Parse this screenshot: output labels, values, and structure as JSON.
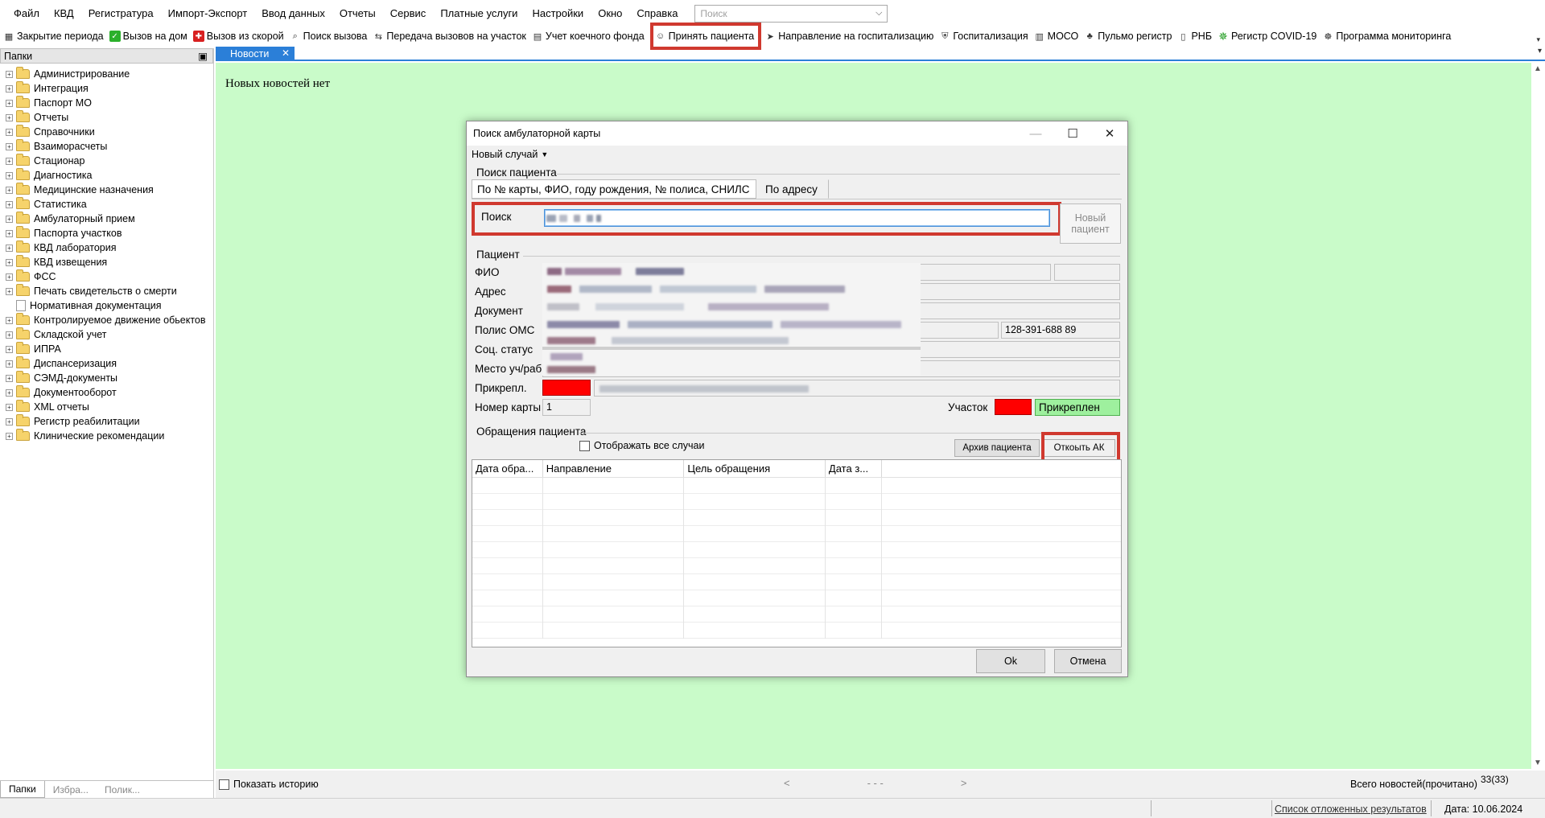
{
  "menubar": {
    "items": [
      "Файл",
      "КВД",
      "Регистратура",
      "Импорт-Экспорт",
      "Ввод данных",
      "Отчеты",
      "Сервис",
      "Платные услуги",
      "Настройки",
      "Окно",
      "Справка"
    ],
    "search_placeholder": "Поиск"
  },
  "toolbar": {
    "items": [
      {
        "label": "Закрытие периода",
        "icon": "period-close-icon"
      },
      {
        "label": "Вызов на дом",
        "icon": "house-call-icon"
      },
      {
        "label": "Вызов из скорой",
        "icon": "ambulance-call-icon"
      },
      {
        "label": "Поиск вызова",
        "icon": "search-call-icon"
      },
      {
        "label": "Передача вызовов на участок",
        "icon": "transfer-icon"
      },
      {
        "label": "Учет коечного фонда",
        "icon": "bed-fund-icon"
      },
      {
        "label": "Принять пациента",
        "icon": "accept-patient-icon"
      },
      {
        "label": "Направление на госпитализацию",
        "icon": "referral-icon"
      },
      {
        "label": "Госпитализация",
        "icon": "hospitalization-icon"
      },
      {
        "label": "МОСО",
        "icon": "moso-icon"
      },
      {
        "label": "Пульмо регистр",
        "icon": "pulmo-icon"
      },
      {
        "label": "РНБ",
        "icon": "rnb-icon"
      },
      {
        "label": "Регистр COVID-19",
        "icon": "covid-icon"
      },
      {
        "label": "Программа мониторинга",
        "icon": "monitoring-icon"
      }
    ]
  },
  "left_panel": {
    "header": "Папки",
    "pin": "⯒",
    "tree": [
      {
        "label": "Администрирование",
        "type": "folder"
      },
      {
        "label": "Интеграция",
        "type": "folder"
      },
      {
        "label": "Паспорт МО",
        "type": "folder"
      },
      {
        "label": "Отчеты",
        "type": "folder"
      },
      {
        "label": "Справочники",
        "type": "folder"
      },
      {
        "label": "Взаиморасчеты",
        "type": "folder"
      },
      {
        "label": "Стационар",
        "type": "folder"
      },
      {
        "label": "Диагностика",
        "type": "folder"
      },
      {
        "label": "Медицинские назначения",
        "type": "folder"
      },
      {
        "label": "Статистика",
        "type": "folder"
      },
      {
        "label": "Амбулаторный прием",
        "type": "folder"
      },
      {
        "label": "Паспорта участков",
        "type": "folder"
      },
      {
        "label": "КВД лаборатория",
        "type": "folder"
      },
      {
        "label": "КВД извещения",
        "type": "folder"
      },
      {
        "label": "ФСС",
        "type": "folder"
      },
      {
        "label": "Печать свидетельств о смерти",
        "type": "folder"
      },
      {
        "label": "Нормативная документация",
        "type": "doc"
      },
      {
        "label": "Контролируемое движение обьектов",
        "type": "folder"
      },
      {
        "label": "Складской учет",
        "type": "folder"
      },
      {
        "label": "ИПРА",
        "type": "folder"
      },
      {
        "label": "Диспансеризация",
        "type": "folder"
      },
      {
        "label": "СЭМД-документы",
        "type": "folder"
      },
      {
        "label": "Документооборот",
        "type": "folder"
      },
      {
        "label": "XML отчеты",
        "type": "folder"
      },
      {
        "label": "Регистр реабилитации",
        "type": "folder"
      },
      {
        "label": "Клинические рекомендации",
        "type": "folder"
      }
    ],
    "bottom_tabs": [
      "Папки",
      "Избра...",
      "Полик..."
    ]
  },
  "doc_tab": {
    "label": "Новости",
    "close": "✕"
  },
  "main": {
    "news_text": "Новых новостей нет",
    "show_history": "Показать историю",
    "nav_prev": "<",
    "nav_mid": "- - -",
    "nav_next": ">",
    "total_label": "Всего новостей(прочитано)",
    "total_count": "33(33)"
  },
  "statusbar": {
    "deferred_results": "Список отложенных результатов",
    "date": "Дата: 10.06.2024"
  },
  "dialog": {
    "title": "Поиск амбулаторной карты",
    "menu_new_case": "Новый случай",
    "search_group": "Поиск пациента",
    "tab_main": "По № карты, ФИО, году рождения, № полиса, СНИЛС",
    "tab_address": "По адресу",
    "search_label": "Поиск",
    "new_patient_btn": "Новый пациент",
    "patient_group": "Пациент",
    "labels": {
      "fio": "ФИО",
      "address": "Адрес",
      "document": "Документ",
      "policy": "Полис ОМС",
      "social": "Соц. статус",
      "workplace": "Место уч/раб",
      "attached": "Прикрепл.",
      "card_number": "Номер карты",
      "district": "Участок"
    },
    "snils": "128-391-688 89",
    "card_number_value": "1",
    "attached_status": "Прикреплен",
    "appeals_group": "Обращения пациента",
    "show_all_cases": "Отображать все случаи",
    "archive_btn": "Архив пациента",
    "open_ak_btn": "Откоыть АК",
    "grid_columns": [
      "Дата обра...",
      "Направление",
      "Цель обращения",
      "Дата з..."
    ],
    "ok_btn": "Ok",
    "cancel_btn": "Отмена"
  },
  "colors": {
    "accent_blue": "#2b7fd8",
    "content_green": "#c9fbc9",
    "highlight_red": "#d0392f",
    "status_red": "#ff0000",
    "attached_green": "#9ef09e"
  }
}
